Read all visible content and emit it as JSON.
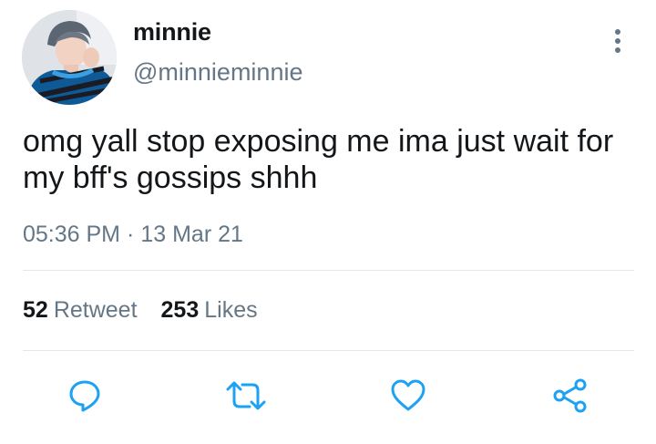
{
  "user": {
    "display_name": "minnie",
    "handle": "@minnieminnie"
  },
  "tweet": {
    "text": "omg yall stop exposing me ima just wait for my bff's gossips shhh",
    "time": "05:36 PM",
    "separator": "·",
    "date": "13 Mar 21"
  },
  "stats": {
    "retweets_count": "52",
    "retweets_label": "Retweet",
    "likes_count": "253",
    "likes_label": "Likes"
  },
  "icons": {
    "more": "more-vertical-icon",
    "reply": "reply-icon",
    "retweet": "retweet-icon",
    "like": "heart-icon",
    "share": "share-icon"
  },
  "colors": {
    "text": "#14171a",
    "secondary": "#657786",
    "icon": "#1da1f2",
    "divider": "#e1e8ed"
  }
}
